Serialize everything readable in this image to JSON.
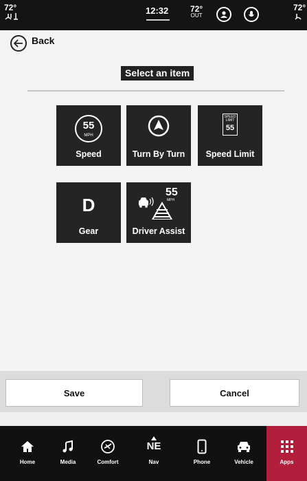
{
  "status_bar": {
    "left_temp": "72°",
    "time": "12:32",
    "outside_temp": "72°",
    "outside_label": "OUT",
    "right_temp": "72°"
  },
  "header": {
    "back_label": "Back",
    "title": "Select an item"
  },
  "tiles": [
    {
      "label": "Speed",
      "icon": "speedometer-55-mph-icon",
      "value": "55",
      "unit": "MPH"
    },
    {
      "label": "Turn By Turn",
      "icon": "navigation-arrow-icon"
    },
    {
      "label": "Speed Limit",
      "icon": "speed-limit-sign-icon",
      "sign_top": "SPEED",
      "sign_mid": "LIMIT",
      "value": "55"
    },
    {
      "label": "Gear",
      "icon": "gear-d-icon",
      "value": "D"
    },
    {
      "label": "Driver Assist",
      "icon": "driver-assist-icon",
      "value": "55",
      "unit": "MPH"
    }
  ],
  "footer": {
    "save_label": "Save",
    "cancel_label": "Cancel"
  },
  "nav": [
    {
      "label": "Home",
      "icon": "home-icon"
    },
    {
      "label": "Media",
      "icon": "music-note-icon"
    },
    {
      "label": "Comfort",
      "icon": "comfort-icon"
    },
    {
      "label": "Nav",
      "icon": "compass-icon",
      "value": "NE"
    },
    {
      "label": "Phone",
      "icon": "phone-icon"
    },
    {
      "label": "Vehicle",
      "icon": "vehicle-icon"
    },
    {
      "label": "Apps",
      "icon": "apps-grid-icon",
      "active": true
    }
  ],
  "colors": {
    "active_tab": "#b31e3d",
    "tile_bg": "#242424",
    "panel_bg": "#f3f3f3"
  }
}
